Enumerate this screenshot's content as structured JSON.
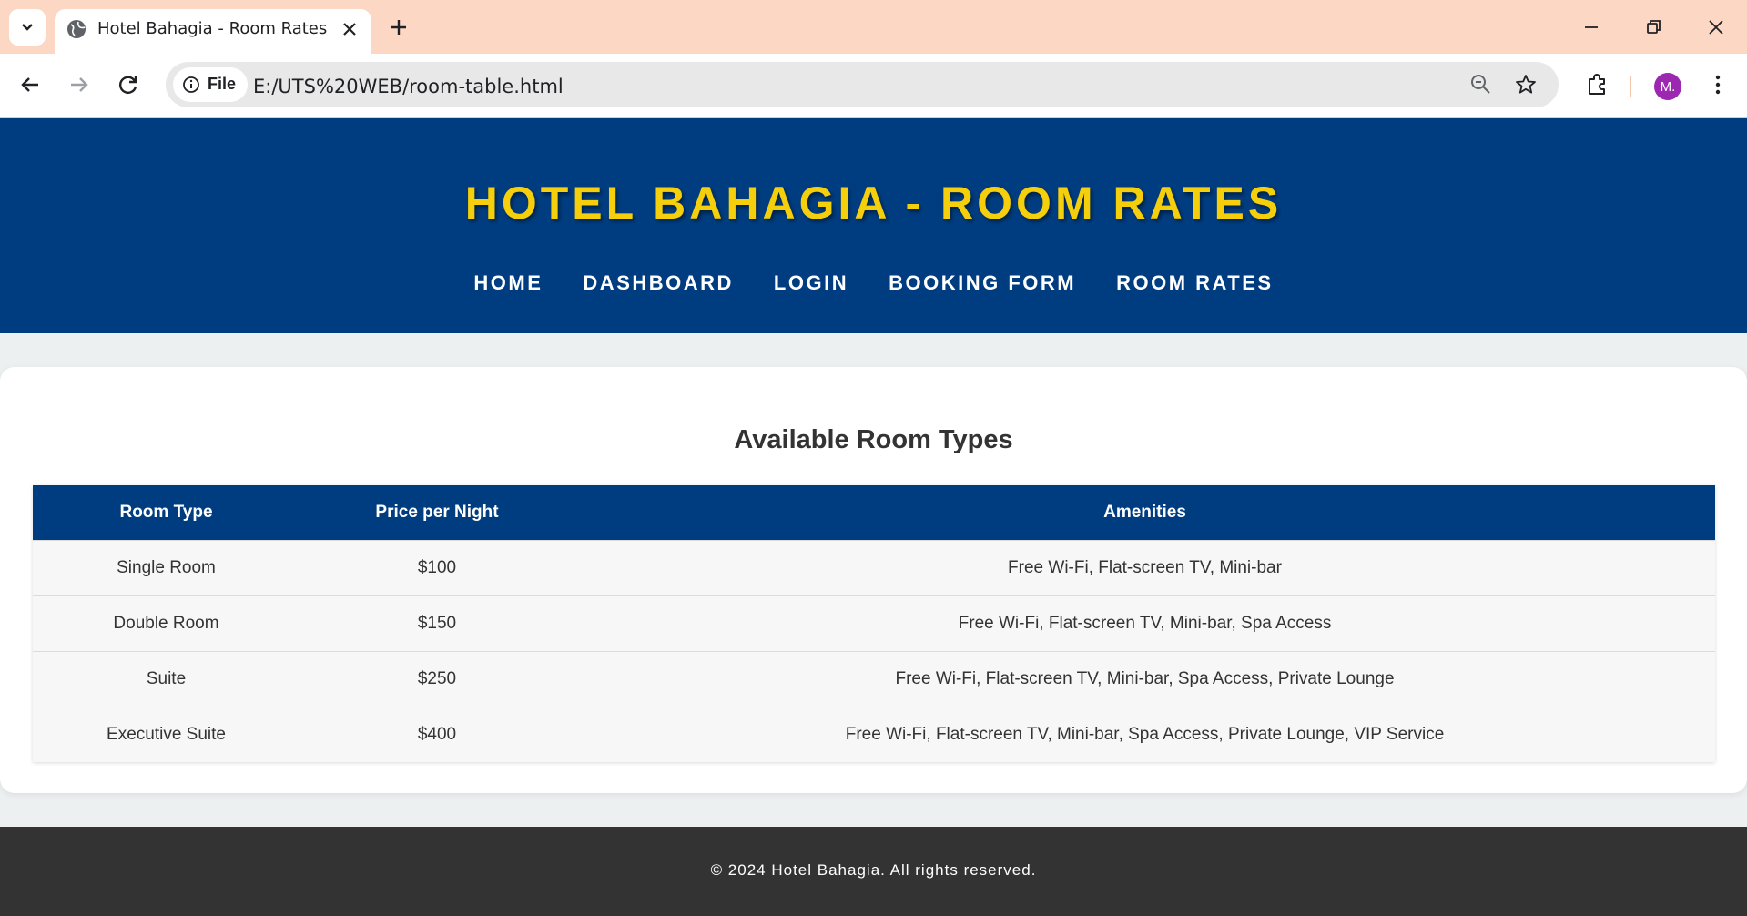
{
  "browser": {
    "tab_title": "Hotel Bahagia - Room Rates",
    "site_chip_label": "File",
    "url": "E:/UTS%20WEB/room-table.html",
    "avatar_initial": "M."
  },
  "header": {
    "title": "HOTEL BAHAGIA - ROOM RATES",
    "nav": [
      "HOME",
      "DASHBOARD",
      "LOGIN",
      "BOOKING FORM",
      "ROOM RATES"
    ]
  },
  "main": {
    "heading": "Available Room Types",
    "table": {
      "columns": [
        "Room Type",
        "Price per Night",
        "Amenities"
      ],
      "rows": [
        [
          "Single Room",
          "$100",
          "Free Wi-Fi, Flat-screen TV, Mini-bar"
        ],
        [
          "Double Room",
          "$150",
          "Free Wi-Fi, Flat-screen TV, Mini-bar, Spa Access"
        ],
        [
          "Suite",
          "$250",
          "Free Wi-Fi, Flat-screen TV, Mini-bar, Spa Access, Private Lounge"
        ],
        [
          "Executive Suite",
          "$400",
          "Free Wi-Fi, Flat-screen TV, Mini-bar, Spa Access, Private Lounge, VIP Service"
        ]
      ]
    }
  },
  "footer": {
    "text": "© 2024 Hotel Bahagia. All rights reserved."
  },
  "colors": {
    "header_bg": "#003d80",
    "title": "#f5cf0b",
    "tabbar": "#fcd8c4",
    "footer_bg": "#333333"
  },
  "icons": [
    "tab-search-icon",
    "globe-icon",
    "close-icon",
    "plus-icon",
    "minimize-icon",
    "restore-icon",
    "close-window-icon",
    "back-icon",
    "forward-icon",
    "reload-icon",
    "info-icon",
    "zoom-icon",
    "star-icon",
    "extensions-icon",
    "menu-icon"
  ]
}
